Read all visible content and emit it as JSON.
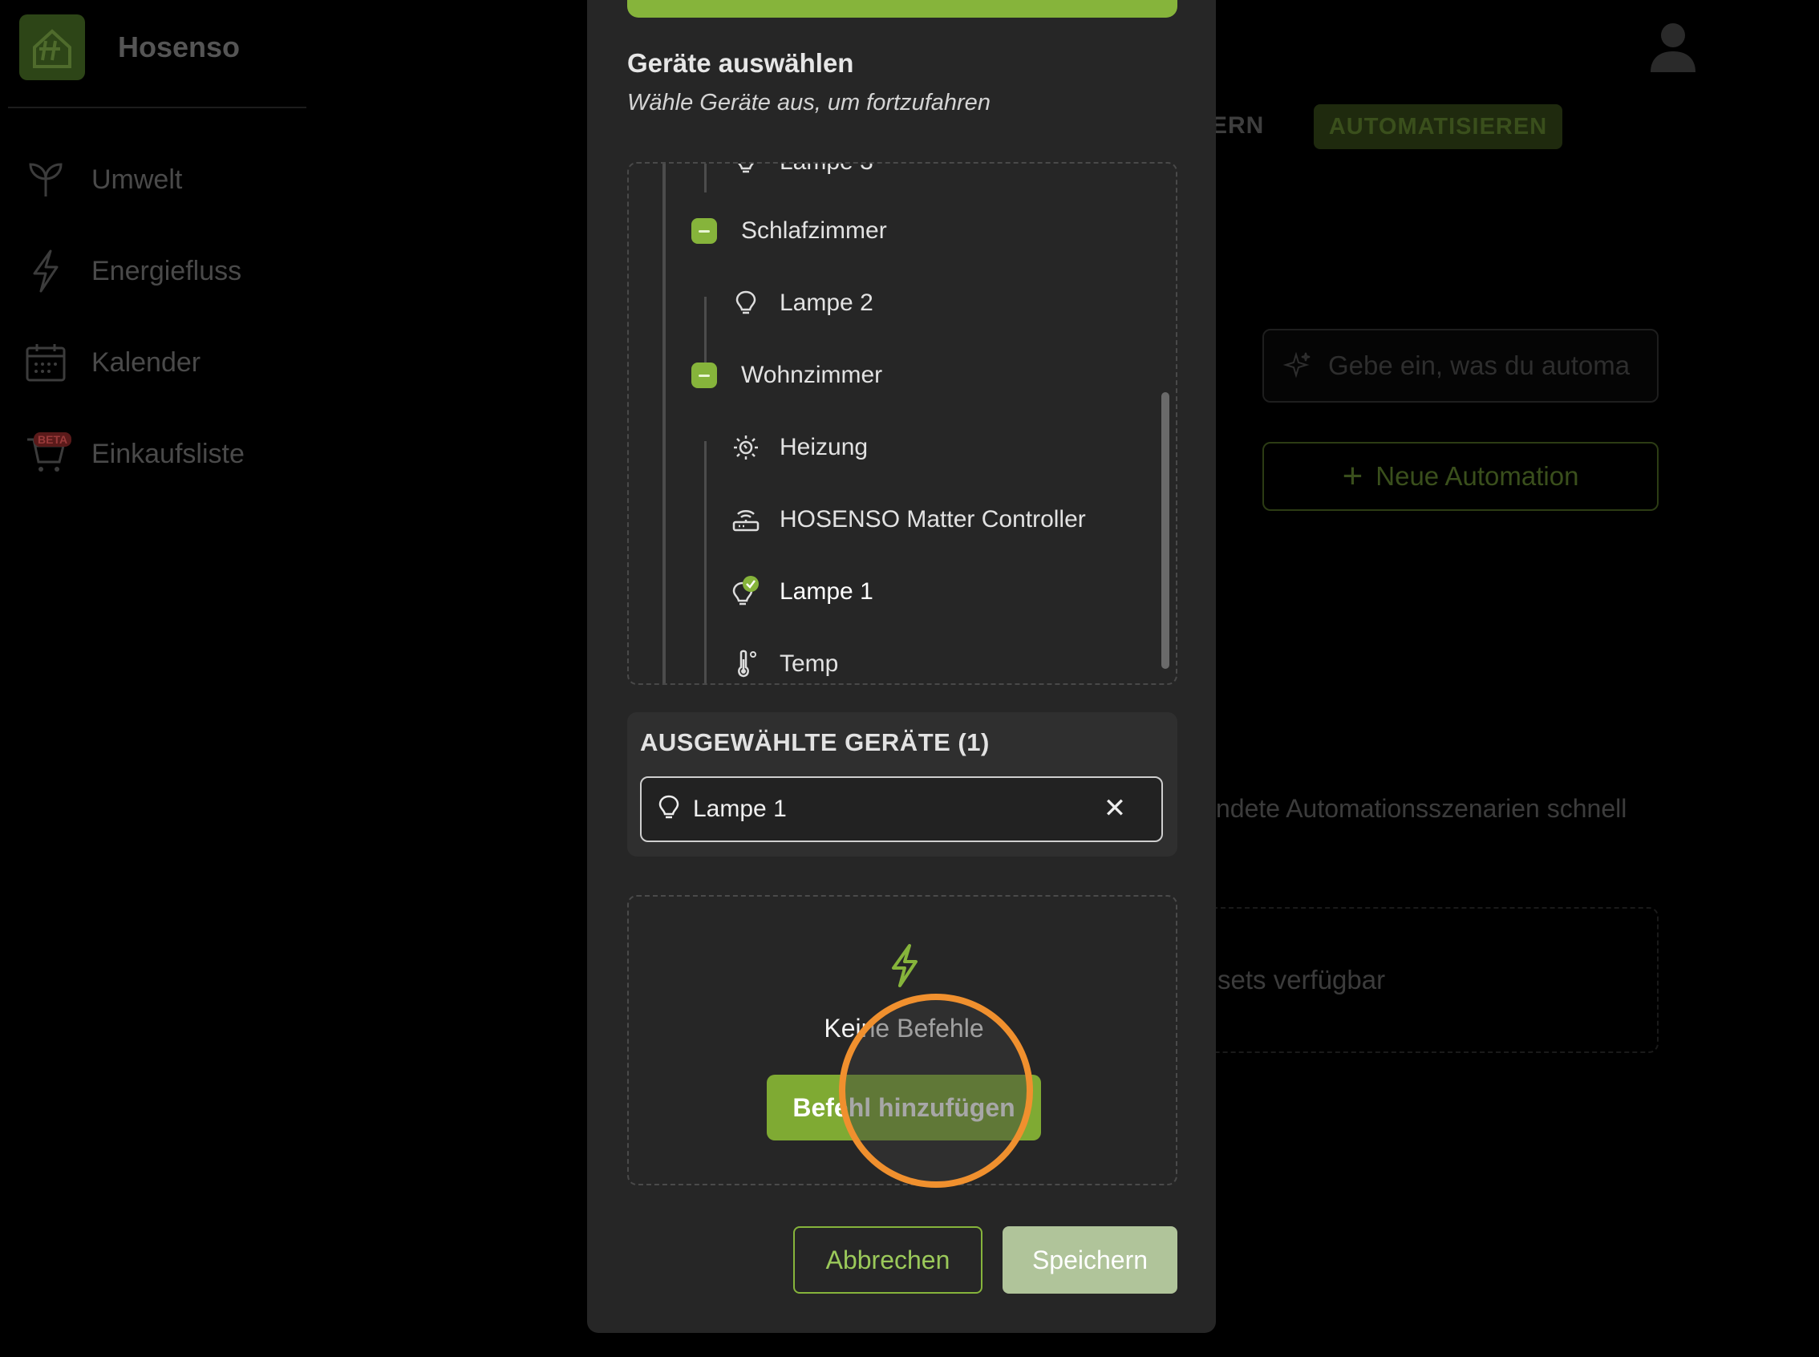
{
  "app": {
    "brand": "Hosenso",
    "nav": [
      {
        "label": "Umwelt",
        "icon": "sprout-icon"
      },
      {
        "label": "Energiefluss",
        "icon": "lightning-icon"
      },
      {
        "label": "Kalender",
        "icon": "calendar-icon"
      },
      {
        "label": "Einkaufsliste",
        "icon": "cart-icon",
        "badge": "BETA"
      }
    ],
    "tabs": {
      "partial": "ERN",
      "active": "AUTOMATISIEREN"
    },
    "prompt_placeholder": "Gebe ein, was du automa",
    "new_automation": "Neue Automation",
    "description_partial": "ndete Automationsszenarien schnell",
    "presets_partial": "sets verfügbar"
  },
  "modal": {
    "title": "Geräte auswählen",
    "subtitle": "Wähle Geräte aus, um fortzufahren",
    "tree": {
      "partial_item": "Lampe 3",
      "rooms": [
        {
          "name": "Schlafzimmer",
          "devices": [
            {
              "name": "Lampe 2",
              "icon": "bulb-icon"
            }
          ]
        },
        {
          "name": "Wohnzimmer",
          "devices": [
            {
              "name": "Heizung",
              "icon": "heater-icon"
            },
            {
              "name": "HOSENSO Matter Controller",
              "icon": "router-icon"
            },
            {
              "name": "Lampe 1",
              "icon": "bulb-icon",
              "selected": true
            },
            {
              "name": "Temp",
              "icon": "thermometer-icon"
            }
          ]
        }
      ]
    },
    "selected": {
      "title": "AUSGEWÄHLTE GERÄTE (1)",
      "items": [
        {
          "name": "Lampe 1",
          "icon": "bulb-icon"
        }
      ],
      "remove_glyph": "✕"
    },
    "commands": {
      "empty_text": "Keine Befehle",
      "add_label": "Befehl hinzufügen"
    },
    "cancel_label": "Abbrechen",
    "save_label": "Speichern"
  },
  "colors": {
    "accent": "#86b43b",
    "modal_bg": "#262626",
    "click_ring": "#f0902e"
  }
}
